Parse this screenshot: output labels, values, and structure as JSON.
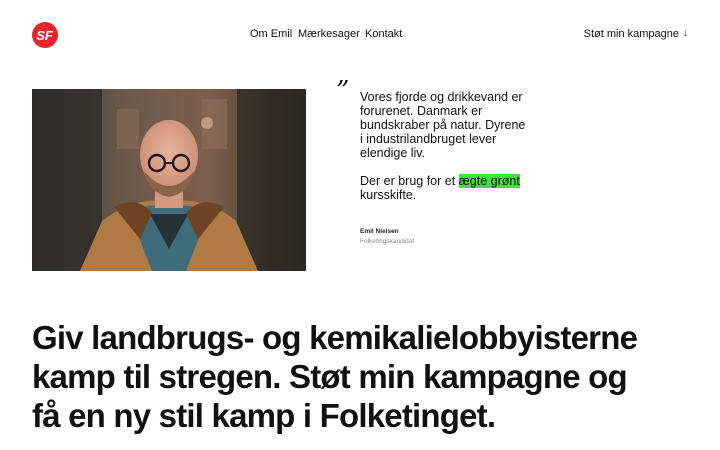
{
  "brand": {
    "logo_text": "SF",
    "logo_color": "#e8222f"
  },
  "nav": {
    "items": [
      {
        "label": "Om Emil"
      },
      {
        "label": "Mærkesager"
      },
      {
        "label": "Kontakt"
      }
    ],
    "cta": {
      "label": "Støt min kampagne",
      "icon": "arrow-down-icon"
    }
  },
  "hero": {
    "quote_mark": "”",
    "quote_line1": "Vores fjorde og drikkevand er forurenet. Danmark er bundskraber på natur. Dyrene i industrilandbruget lever elendige liv.",
    "quote_line2_before": "Der er brug for et ",
    "quote_highlight": "ægte grønt",
    "quote_line2_after": " kursskifte.",
    "highlight_color": "#41e03e",
    "author_name": "Emil Nielsen",
    "author_role": "Folketingskandidat"
  },
  "headline": "Giv landbrugs- og kemikalielobbyisterne kamp til stregen. Støt min kampagne og få en ny stil kamp i Folketinget."
}
